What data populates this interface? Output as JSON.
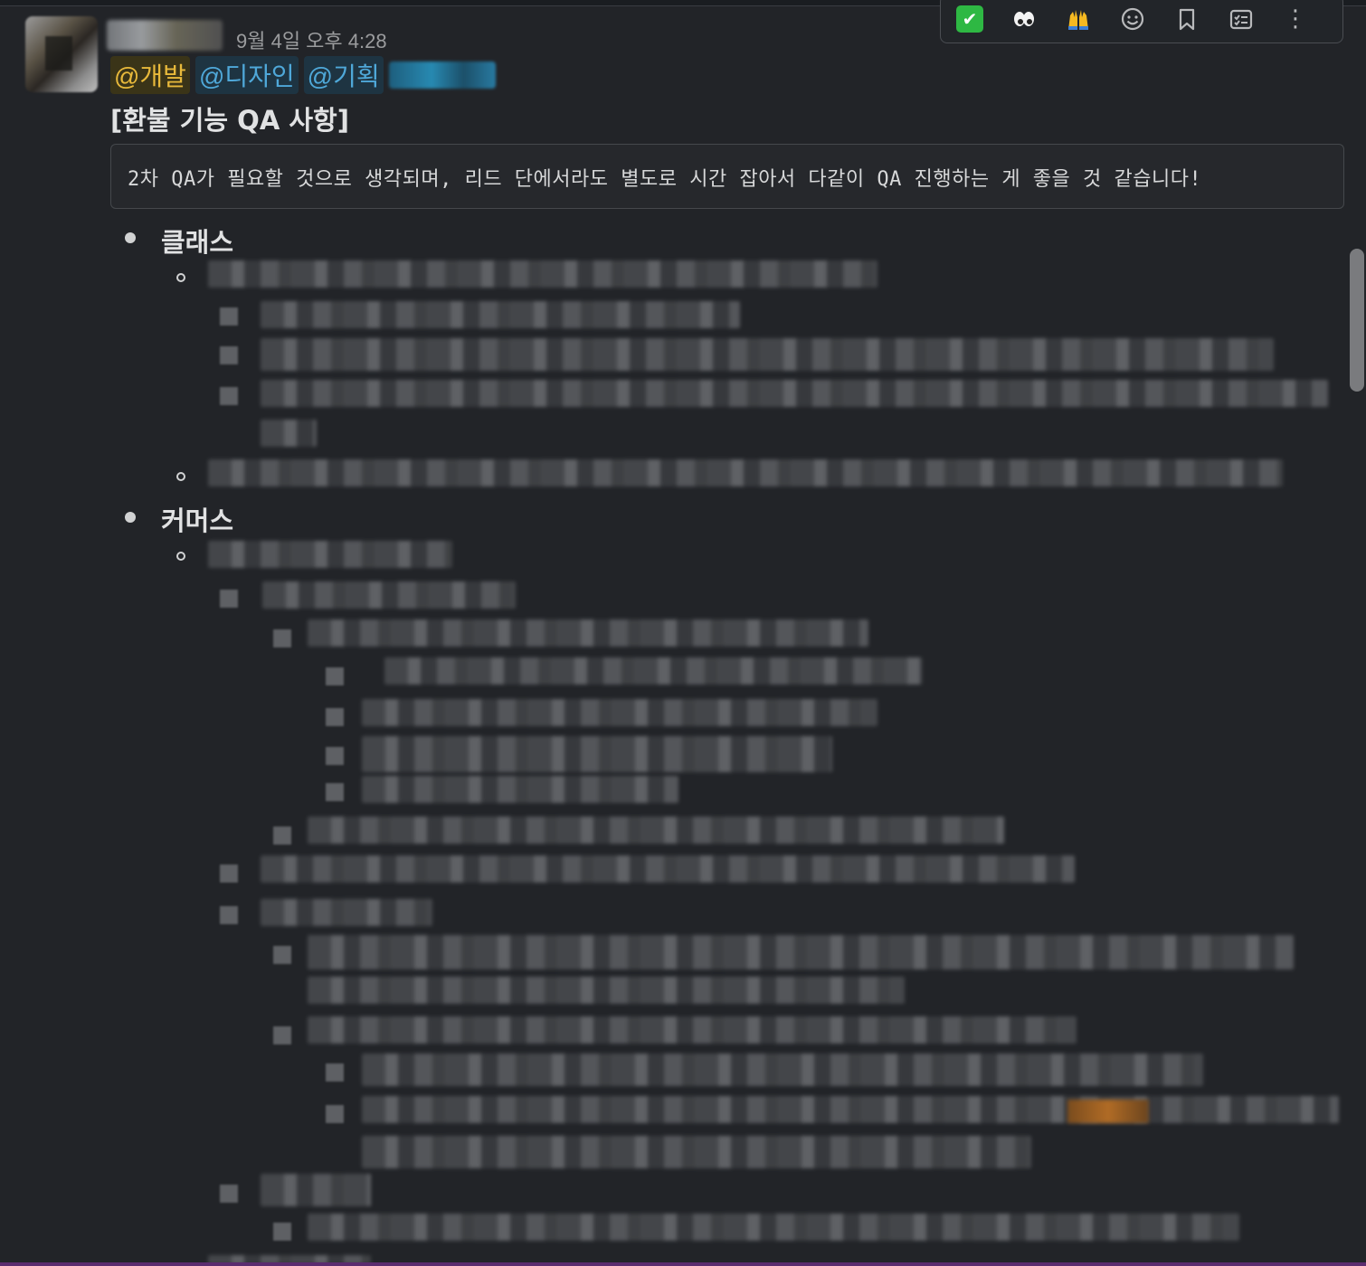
{
  "message": {
    "timestamp": "9월 4일 오후 4:28",
    "mentions": [
      "@개발",
      "@디자인",
      "@기획"
    ],
    "title": "[환불 기능 QA 사항]",
    "quote": "2차 QA가 필요할 것으로 생각되며, 리드 단에서라도 별도로 시간 잡아서 다같이 QA 진행하는 게 좋을 것 같습니다!",
    "sections": [
      "클래스",
      "커머스"
    ]
  },
  "toolbar": {
    "icons": [
      "check-mark-emoji-icon",
      "eyes-emoji-icon",
      "raised-hands-emoji-icon",
      "add-reaction-icon",
      "bookmark-icon",
      "checklist-icon",
      "more-icon"
    ],
    "check": "✔",
    "eyes": "👀",
    "hands": "🙌",
    "more": "⋮"
  },
  "colors": {
    "background": "#222428",
    "mention_yellow": "#e8b93b",
    "mention_blue": "#4fa8d9",
    "check_green": "#2eb843"
  }
}
